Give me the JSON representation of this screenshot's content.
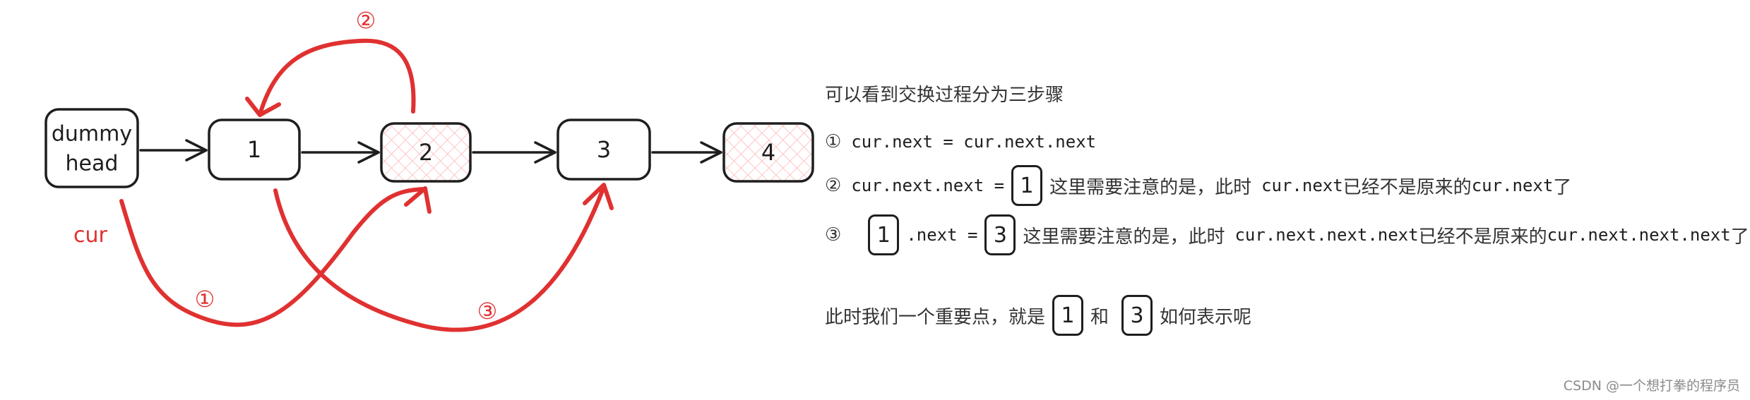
{
  "diagram": {
    "nodes": [
      {
        "id": "dummy",
        "label_lines": [
          "dummy",
          "head"
        ],
        "highlighted": false
      },
      {
        "id": "n1",
        "label_lines": [
          "1"
        ],
        "highlighted": false
      },
      {
        "id": "n2",
        "label_lines": [
          "2"
        ],
        "highlighted": true
      },
      {
        "id": "n3",
        "label_lines": [
          "3"
        ],
        "highlighted": false
      },
      {
        "id": "n4",
        "label_lines": [
          "4"
        ],
        "highlighted": true
      }
    ],
    "edges": [
      {
        "from": "dummy",
        "to": "n1"
      },
      {
        "from": "n1",
        "to": "n2"
      },
      {
        "from": "n2",
        "to": "n3"
      },
      {
        "from": "n3",
        "to": "n4"
      }
    ],
    "steps": [
      {
        "marker": "①",
        "from": "dummy",
        "to": "n2"
      },
      {
        "marker": "②",
        "from": "n2",
        "to": "n1"
      },
      {
        "marker": "③",
        "from": "n1",
        "to": "n3"
      }
    ],
    "pointer_label": "cur",
    "colors": {
      "ink": "#1e1e1e",
      "accent": "#e03131",
      "highlight_fill": "#ffc9c9"
    }
  },
  "notes": {
    "title": "可以看到交换过程分为三步骤",
    "step1": {
      "marker": "①",
      "code": "cur.next = cur.next.next"
    },
    "step2": {
      "marker": "②",
      "code_before": "cur.next.next =",
      "box": "1",
      "text1": "这里需要注意的是，此时",
      "code_mid": "cur.next",
      "text2": "已经不是原来的",
      "code_end": "cur.next",
      "text3": "了"
    },
    "step3": {
      "marker": "③",
      "box_a": "1",
      "code_mid": ".next =",
      "box_b": "3",
      "text1": "这里需要注意的是，此时",
      "code_mid2": "cur.next.next.next",
      "text2": "已经不是原来的",
      "code_end": "cur.next.next.next",
      "text3": "了"
    },
    "summary": {
      "text1": "此时我们一个重要点，就是",
      "box_a": "1",
      "and": "和",
      "box_b": "3",
      "text2": "如何表示呢"
    }
  },
  "watermark": "CSDN @一个想打拳的程序员"
}
